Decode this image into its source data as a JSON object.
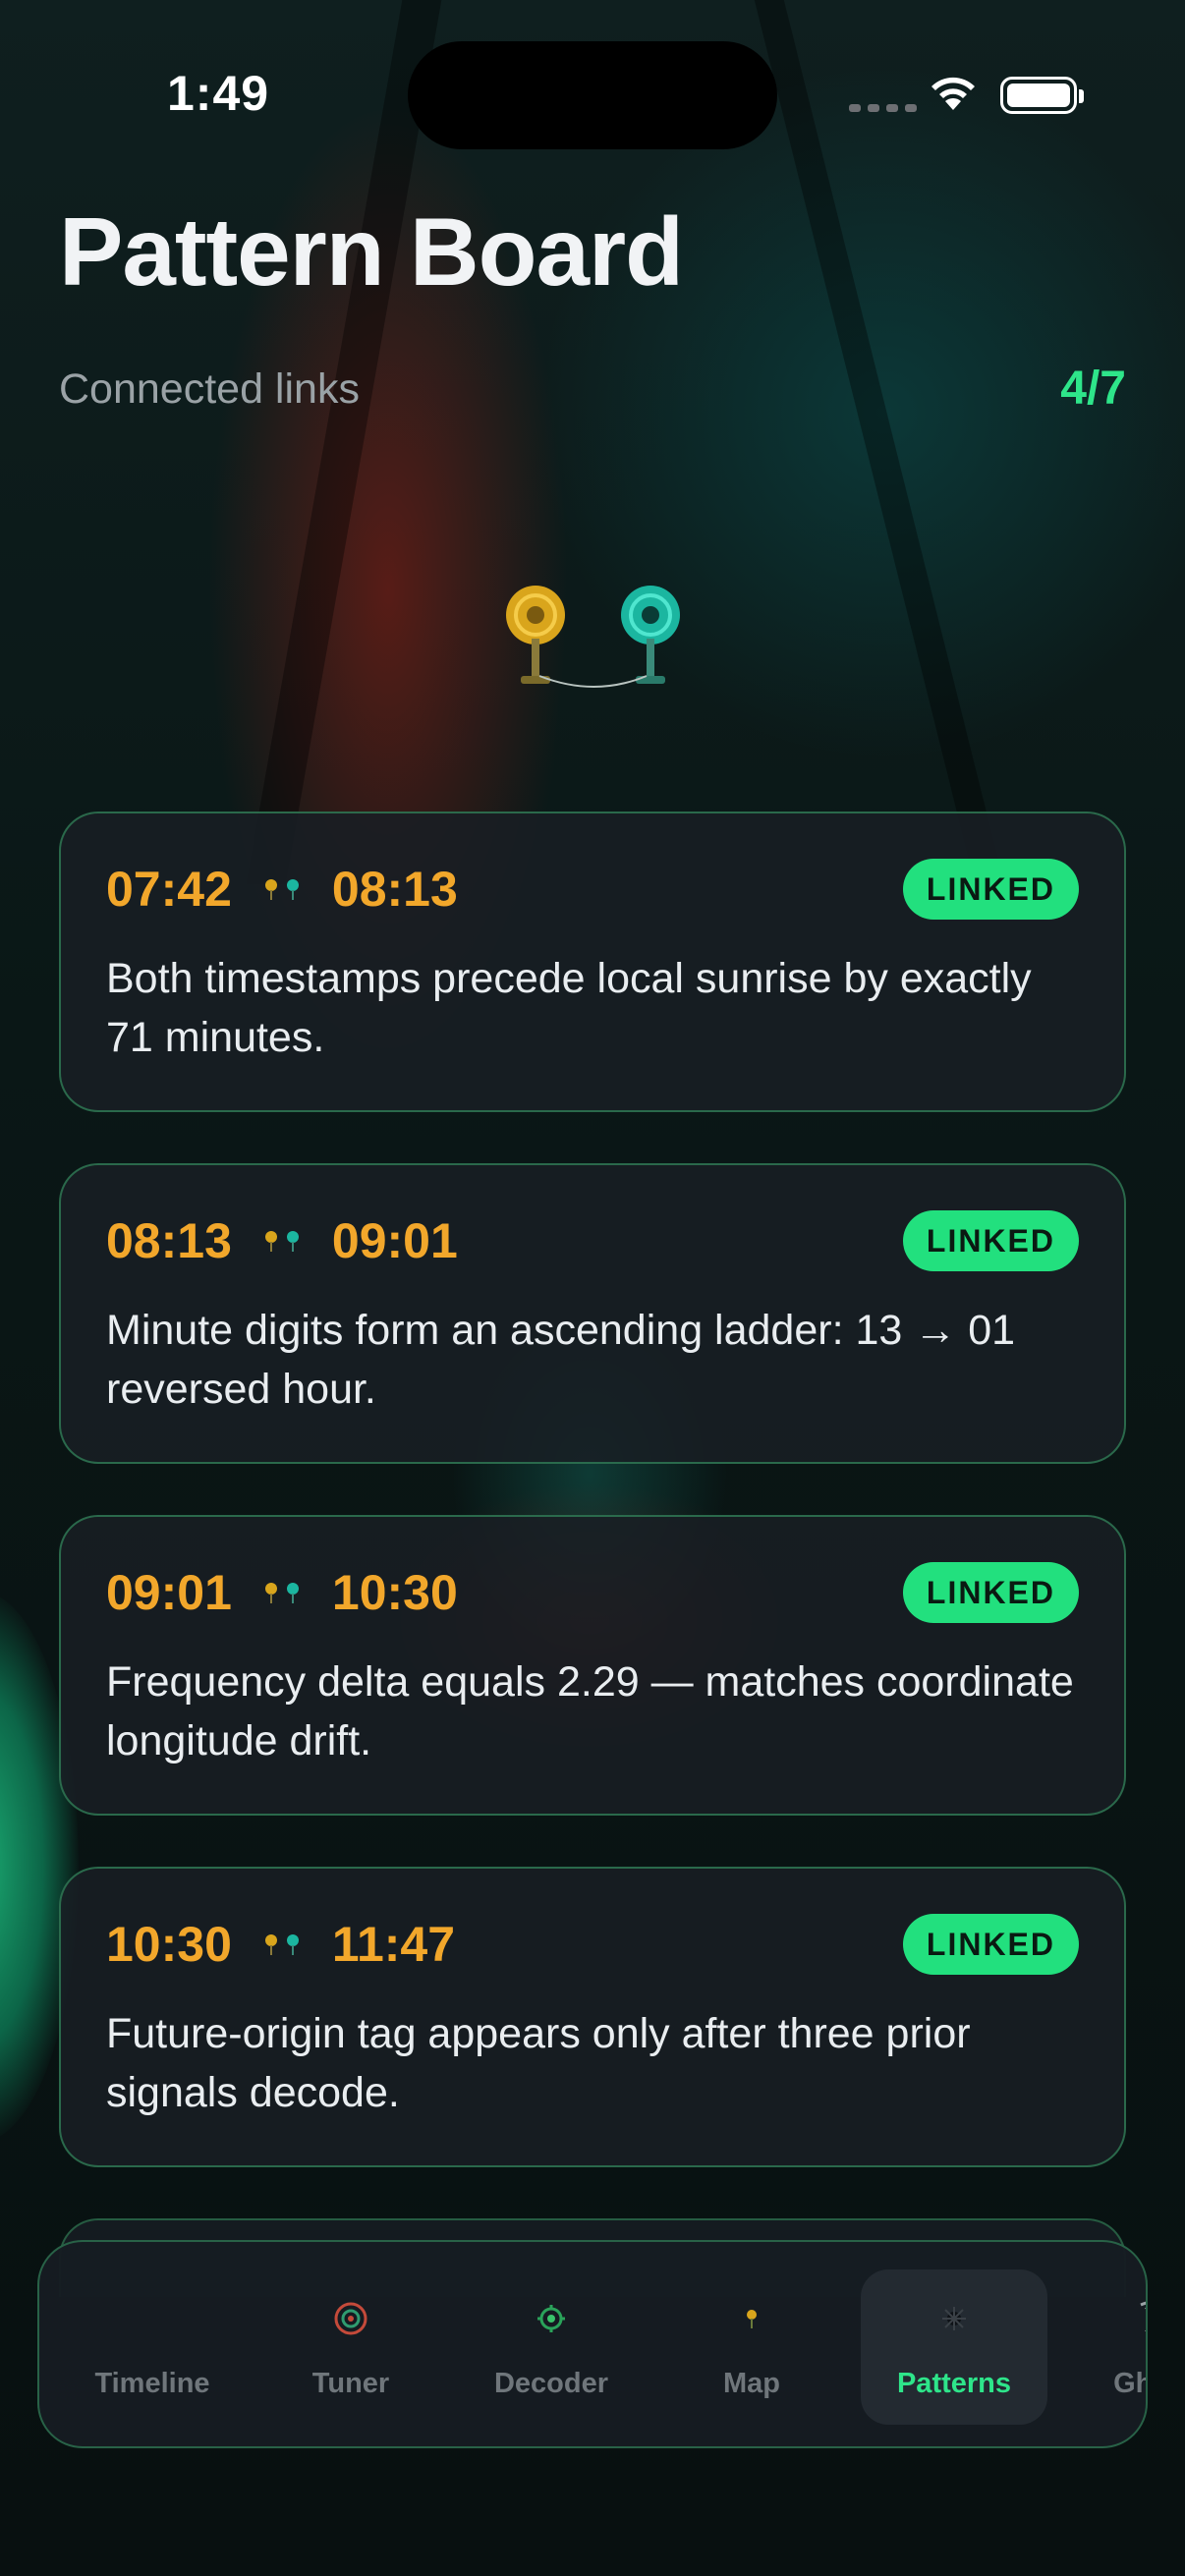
{
  "status": {
    "time": "1:49"
  },
  "header": {
    "title": "Pattern Board",
    "subtitle": "Connected links",
    "count": "4/7"
  },
  "colors": {
    "accent": "#2ee58a",
    "timestamp": "#f2a72b",
    "badge": "#22e07e",
    "card_border": "#3caa6e"
  },
  "links": [
    {
      "from": "07:42",
      "to": "08:13",
      "status": "LINKED",
      "description": "Both timestamps precede local sunrise by exactly 71 minutes."
    },
    {
      "from": "08:13",
      "to": "09:01",
      "status": "LINKED",
      "description": "Minute digits form an ascending ladder: 13 → 01 reversed hour."
    },
    {
      "from": "09:01",
      "to": "10:30",
      "status": "LINKED",
      "description": "Frequency delta equals 2.29 — matches coordinate longitude drift."
    },
    {
      "from": "10:30",
      "to": "11:47",
      "status": "LINKED",
      "description": "Future-origin tag appears only after three prior signals decode."
    }
  ],
  "tabbar": {
    "active": "Patterns",
    "tabs": [
      {
        "label": "Timeline",
        "icon": "timeline-icon"
      },
      {
        "label": "Tuner",
        "icon": "dial-icon"
      },
      {
        "label": "Decoder",
        "icon": "radar-icon"
      },
      {
        "label": "Map",
        "icon": "pin-icon"
      },
      {
        "label": "Patterns",
        "icon": "pattern-web-icon"
      },
      {
        "label": "Ghost",
        "icon": "hourglass-icon"
      }
    ]
  }
}
